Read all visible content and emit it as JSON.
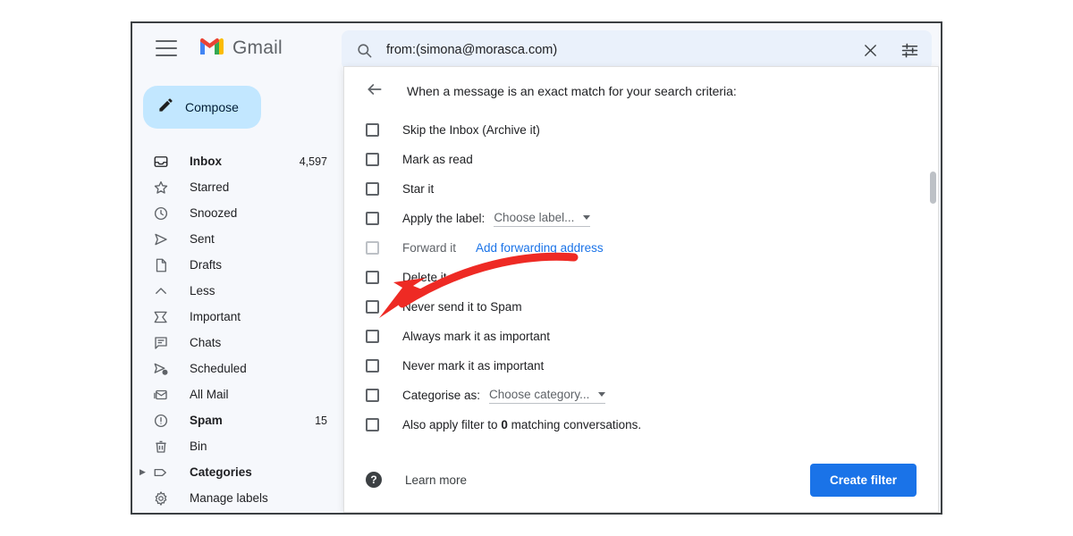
{
  "app": {
    "brand_name": "Gmail",
    "menu_icon": "hamburger-icon",
    "logo_icon": "gmail-logo-icon"
  },
  "search": {
    "value": "from:(simona@morasca.com)",
    "search_icon": "search-icon",
    "clear_icon": "close-icon",
    "options_icon": "filter-options-icon"
  },
  "sidebar": {
    "compose": {
      "label": "Compose",
      "icon": "pencil-icon"
    },
    "items": [
      {
        "label": "Inbox",
        "count": "4,597",
        "icon": "inbox-icon",
        "bold": true,
        "expandable": false
      },
      {
        "label": "Starred",
        "count": "",
        "icon": "star-icon",
        "bold": false,
        "expandable": false
      },
      {
        "label": "Snoozed",
        "count": "",
        "icon": "clock-icon",
        "bold": false,
        "expandable": false
      },
      {
        "label": "Sent",
        "count": "",
        "icon": "send-icon",
        "bold": false,
        "expandable": false
      },
      {
        "label": "Drafts",
        "count": "",
        "icon": "document-icon",
        "bold": false,
        "expandable": false
      },
      {
        "label": "Less",
        "count": "",
        "icon": "chevron-up-icon",
        "bold": false,
        "expandable": false
      },
      {
        "label": "Important",
        "count": "",
        "icon": "important-icon",
        "bold": false,
        "expandable": false
      },
      {
        "label": "Chats",
        "count": "",
        "icon": "chat-icon",
        "bold": false,
        "expandable": false
      },
      {
        "label": "Scheduled",
        "count": "",
        "icon": "scheduled-icon",
        "bold": false,
        "expandable": false
      },
      {
        "label": "All Mail",
        "count": "",
        "icon": "mail-stack-icon",
        "bold": false,
        "expandable": false
      },
      {
        "label": "Spam",
        "count": "15",
        "icon": "spam-icon",
        "bold": true,
        "expandable": false
      },
      {
        "label": "Bin",
        "count": "",
        "icon": "trash-icon",
        "bold": false,
        "expandable": false
      },
      {
        "label": "Categories",
        "count": "",
        "icon": "label-icon",
        "bold": true,
        "expandable": true
      },
      {
        "label": "Manage labels",
        "count": "",
        "icon": "gear-icon",
        "bold": false,
        "expandable": false
      }
    ]
  },
  "filter_dialog": {
    "back_icon": "back-arrow-icon",
    "header": "When a message is an exact match for your search criteria:",
    "options": [
      {
        "label": "Skip the Inbox (Archive it)",
        "type": "checkbox",
        "checked": false,
        "dimmed": false
      },
      {
        "label": "Mark as read",
        "type": "checkbox",
        "checked": false,
        "dimmed": false
      },
      {
        "label": "Star it",
        "type": "checkbox",
        "checked": false,
        "dimmed": false
      },
      {
        "label": "Apply the label:",
        "type": "dropdown",
        "checked": false,
        "dimmed": false,
        "dropdown_value": "Choose label..."
      },
      {
        "label": "Forward it",
        "type": "link",
        "checked": false,
        "dimmed": true,
        "link_text": "Add forwarding address"
      },
      {
        "label": "Delete it",
        "type": "checkbox",
        "checked": false,
        "dimmed": false
      },
      {
        "label": "Never send it to Spam",
        "type": "checkbox",
        "checked": false,
        "dimmed": false
      },
      {
        "label": "Always mark it as important",
        "type": "checkbox",
        "checked": false,
        "dimmed": false
      },
      {
        "label": "Never mark it as important",
        "type": "checkbox",
        "checked": false,
        "dimmed": false
      },
      {
        "label": "Categorise as:",
        "type": "dropdown",
        "checked": false,
        "dimmed": false,
        "dropdown_value": "Choose category..."
      }
    ],
    "apply_existing": {
      "prefix": "Also apply filter to",
      "count": "0",
      "suffix": "matching conversations."
    },
    "footer": {
      "help_icon": "help-icon",
      "help_glyph": "?",
      "learn_more": "Learn more",
      "create_filter": "Create filter"
    }
  },
  "annotation": {
    "type": "arrow",
    "color": "#ee2a24",
    "points_to": "Never send it to Spam"
  },
  "colors": {
    "accent_blue": "#1a73e8",
    "compose_bg": "#c2e7ff",
    "search_bg": "#eaf1fb",
    "window_bg": "#f6f8fc",
    "annotation_red": "#ee2a24"
  }
}
